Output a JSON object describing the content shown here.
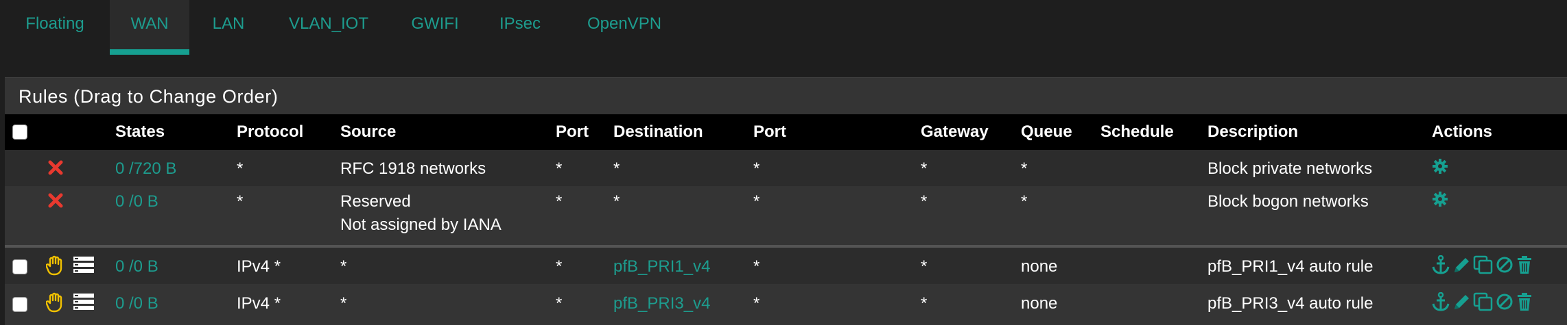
{
  "tabs": [
    {
      "label": "Floating",
      "active": false
    },
    {
      "label": "WAN",
      "active": true
    },
    {
      "label": "LAN",
      "active": false
    },
    {
      "label": "VLAN_IOT",
      "active": false
    },
    {
      "label": "GWIFI",
      "active": false
    },
    {
      "label": "IPsec",
      "active": false
    },
    {
      "label": "OpenVPN",
      "active": false
    }
  ],
  "panel": {
    "title": "Rules (Drag to Change Order)"
  },
  "columns": [
    "States",
    "Protocol",
    "Source",
    "Port",
    "Destination",
    "Port",
    "Gateway",
    "Queue",
    "Schedule",
    "Description",
    "Actions"
  ],
  "rows": [
    {
      "status_icon": "block-x-icon",
      "states": "0 /720 B",
      "protocol": "*",
      "source": "RFC 1918 networks",
      "source_line2": "",
      "port": "*",
      "destination": "*",
      "dest_port": "*",
      "gateway": "*",
      "queue": "*",
      "schedule": "",
      "description": "Block private networks",
      "actions": [
        "gear-icon"
      ]
    },
    {
      "status_icon": "block-x-icon",
      "states": "0 /0 B",
      "protocol": "*",
      "source": "Reserved",
      "source_line2": "Not assigned by IANA",
      "port": "*",
      "destination": "*",
      "dest_port": "*",
      "gateway": "*",
      "queue": "*",
      "schedule": "",
      "description": "Block bogon networks",
      "actions": [
        "gear-icon"
      ]
    },
    {
      "status_icon": "hand-icon",
      "states": "0 /0 B",
      "protocol": "IPv4 *",
      "source": "*",
      "source_line2": "",
      "port": "*",
      "destination": "pfB_PRI1_v4",
      "dest_port": "*",
      "gateway": "*",
      "queue": "none",
      "schedule": "",
      "description": "pfB_PRI1_v4 auto rule",
      "actions": [
        "anchor-icon",
        "pencil-icon",
        "copy-icon",
        "disable-icon",
        "trash-icon"
      ]
    },
    {
      "status_icon": "hand-icon",
      "states": "0 /0 B",
      "protocol": "IPv4 *",
      "source": "*",
      "source_line2": "",
      "port": "*",
      "destination": "pfB_PRI3_v4",
      "dest_port": "*",
      "gateway": "*",
      "queue": "none",
      "schedule": "",
      "description": "pfB_PRI3_v4 auto rule",
      "actions": [
        "anchor-icon",
        "pencil-icon",
        "copy-icon",
        "disable-icon",
        "trash-icon"
      ]
    }
  ],
  "colors": {
    "accent": "#16a091",
    "link": "#1d9c8e",
    "block": "#e8392f",
    "hand": "#f2c200",
    "header_bg": "#000000",
    "panel_bg": "#343434"
  }
}
